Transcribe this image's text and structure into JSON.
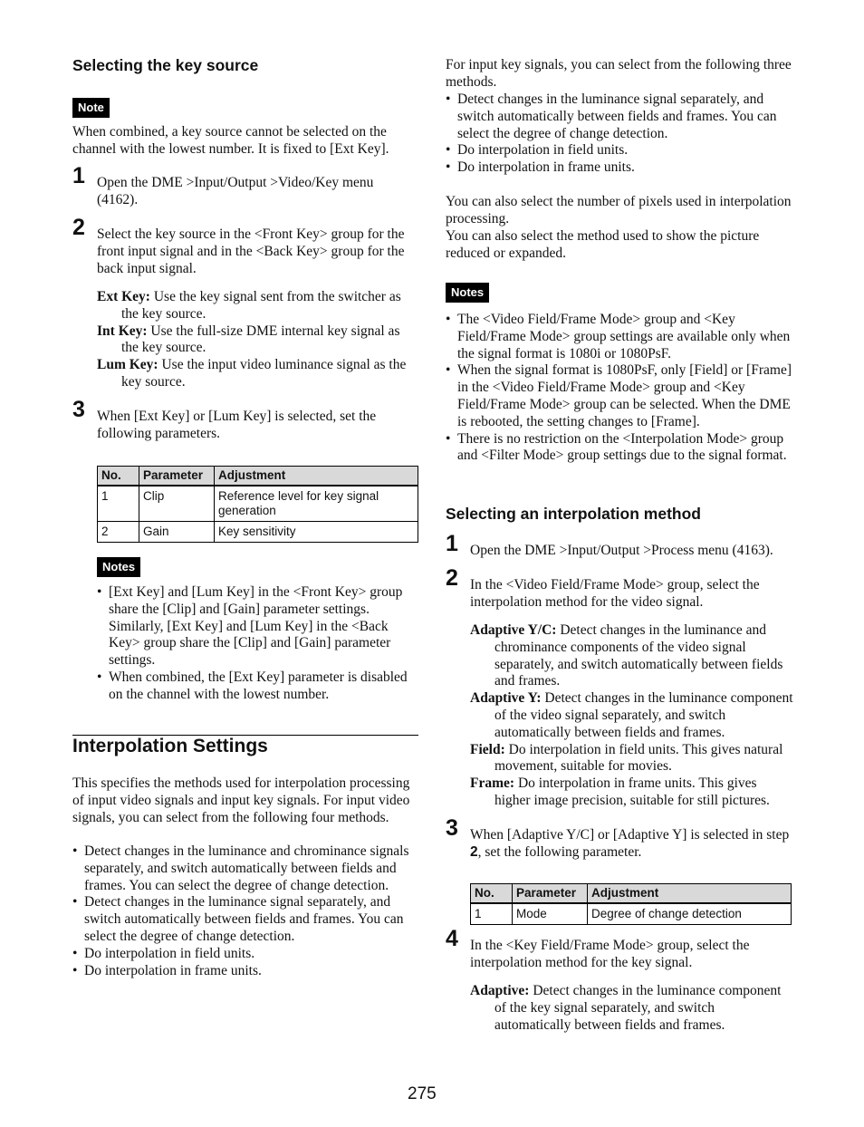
{
  "left": {
    "heading_key_source": "Selecting the key source",
    "note_badge": "Note",
    "note_text": "When combined, a key source cannot be selected on the channel with the lowest number. It is fixed to [Ext Key].",
    "steps": [
      {
        "num": "1",
        "text": "Open the DME >Input/Output >Video/Key menu (4162)."
      },
      {
        "num": "2",
        "text": "Select the key source in the <Front Key> group for the front input signal and in the <Back Key> group for the back input signal."
      },
      {
        "num": "3",
        "text": "When [Ext Key] or [Lum Key] is selected, set the following parameters."
      }
    ],
    "definitions": [
      {
        "term": "Ext Key:",
        "desc": " Use the key signal sent from the switcher as the key source."
      },
      {
        "term": "Int Key:",
        "desc": " Use the full-size DME internal key signal as the key source."
      },
      {
        "term": "Lum Key:",
        "desc": " Use the input video luminance signal as the key source."
      }
    ],
    "table": {
      "headers": [
        "No.",
        "Parameter",
        "Adjustment"
      ],
      "rows": [
        [
          "1",
          "Clip",
          "Reference level for key signal generation"
        ],
        [
          "2",
          "Gain",
          "Key sensitivity"
        ]
      ]
    },
    "notes_badge": "Notes",
    "notes": [
      "[Ext Key] and [Lum Key] in the <Front Key> group share the [Clip] and [Gain] parameter settings. Similarly, [Ext Key] and [Lum Key] in the <Back Key> group share the [Clip] and [Gain] parameter settings.",
      "When combined, the [Ext Key] parameter is disabled on the channel with the lowest number."
    ],
    "section_title": "Interpolation Settings",
    "intro": "This specifies the methods used for interpolation processing of input video signals and input key signals. For input video signals, you can select from the following four methods.",
    "video_methods": [
      "Detect changes in the luminance and chrominance signals separately, and switch automatically between fields and frames. You can select the degree of change detection.",
      "Detect changes in the luminance signal separately, and switch automatically between fields and frames. You can select the degree of change detection.",
      "Do interpolation in field units.",
      "Do interpolation in frame units."
    ]
  },
  "right": {
    "key_intro": "For input key signals, you can select from the following three methods.",
    "key_methods": [
      "Detect changes in the luminance signal separately, and switch automatically between fields and frames. You can select the degree of change detection.",
      "Do interpolation in field units.",
      "Do interpolation in frame units."
    ],
    "pixels_text": "You can also select the number of pixels used in interpolation processing.",
    "method_text": "You can also select the method used to show the picture reduced or expanded.",
    "notes_badge": "Notes",
    "notes": [
      "The <Video Field/Frame Mode> group and <Key Field/Frame Mode> group settings are available only when the signal format is 1080i or 1080PsF.",
      "When the signal format is 1080PsF, only [Field] or [Frame] in the <Video Field/Frame Mode> group and <Key Field/Frame Mode> group can be selected. When the DME is rebooted, the setting changes to [Frame].",
      "There is no restriction on the <Interpolation Mode> group and <Filter Mode> group settings due to the signal format."
    ],
    "heading_interp": "Selecting an interpolation method",
    "steps": [
      {
        "num": "1",
        "text": "Open the DME >Input/Output >Process menu (4163)."
      },
      {
        "num": "2",
        "text": "In the <Video Field/Frame Mode> group, select the interpolation method for the video signal."
      },
      {
        "num": "3",
        "text_a": "When [Adaptive Y/C] or [Adaptive Y] is selected in step ",
        "text_bold": "2",
        "text_b": ", set the following parameter."
      },
      {
        "num": "4",
        "text": "In the <Key Field/Frame Mode> group, select the interpolation method for the key signal."
      }
    ],
    "definitions": [
      {
        "term": "Adaptive Y/C:",
        "desc": " Detect changes in the luminance and chrominance components of the video signal separately, and switch automatically between fields and frames."
      },
      {
        "term": "Adaptive Y:",
        "desc": " Detect changes in the luminance component of the video signal separately, and switch automatically between fields and frames."
      },
      {
        "term": "Field:",
        "desc": " Do interpolation in field units. This gives natural movement, suitable for movies."
      },
      {
        "term": "Frame:",
        "desc": " Do interpolation in frame units. This gives higher image precision, suitable for still pictures."
      }
    ],
    "table": {
      "headers": [
        "No.",
        "Parameter",
        "Adjustment"
      ],
      "rows": [
        [
          "1",
          "Mode",
          "Degree of change detection"
        ]
      ]
    },
    "key_definitions": [
      {
        "term": "Adaptive:",
        "desc": " Detect changes in the luminance component of the key signal separately, and switch automatically between fields and frames."
      }
    ]
  },
  "page_number": "275"
}
